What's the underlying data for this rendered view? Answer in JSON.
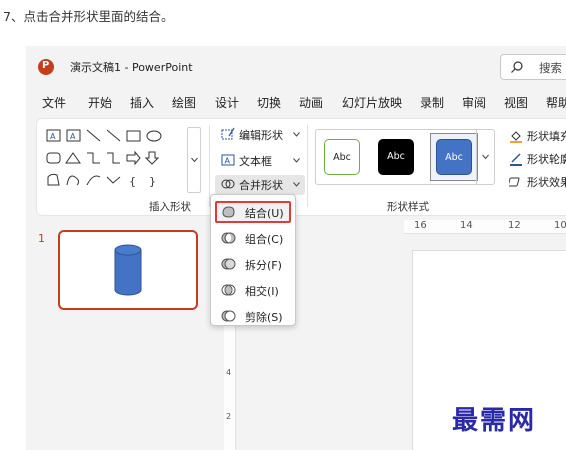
{
  "instruction": "7、点击合并形状里面的结合。",
  "titlebar": {
    "title": "演示文稿1 - PowerPoint",
    "search_label": "搜索"
  },
  "tabs": [
    "文件",
    "开始",
    "插入",
    "绘图",
    "设计",
    "切换",
    "动画",
    "幻灯片放映",
    "录制",
    "审阅",
    "视图",
    "帮助"
  ],
  "ribbon": {
    "insert_shapes_label": "插入形状",
    "edit_shape_label": "编辑形状",
    "text_box_label": "文本框",
    "merge_shapes_label": "合并形状",
    "shape_styles_label": "形状样式",
    "style_swatch_label": "Abc",
    "format_commands": [
      "形状填充",
      "形状轮廓",
      "形状效果"
    ]
  },
  "thumbnail": {
    "number": "1"
  },
  "ruler": {
    "top_ticks": [
      "16",
      "14",
      "12",
      "10"
    ],
    "left_ticks": [
      "4",
      "2"
    ]
  },
  "merge_menu": {
    "items": [
      "结合(U)",
      "组合(C)",
      "拆分(F)",
      "相交(I)",
      "剪除(S)"
    ],
    "highlighted_index": 0
  },
  "watermark": "最需网",
  "colors": {
    "accent": "#c43e1c",
    "highlight_border": "#e03a3a",
    "shape_fill": "#4472c4",
    "watermark": "#2a2aa8"
  }
}
